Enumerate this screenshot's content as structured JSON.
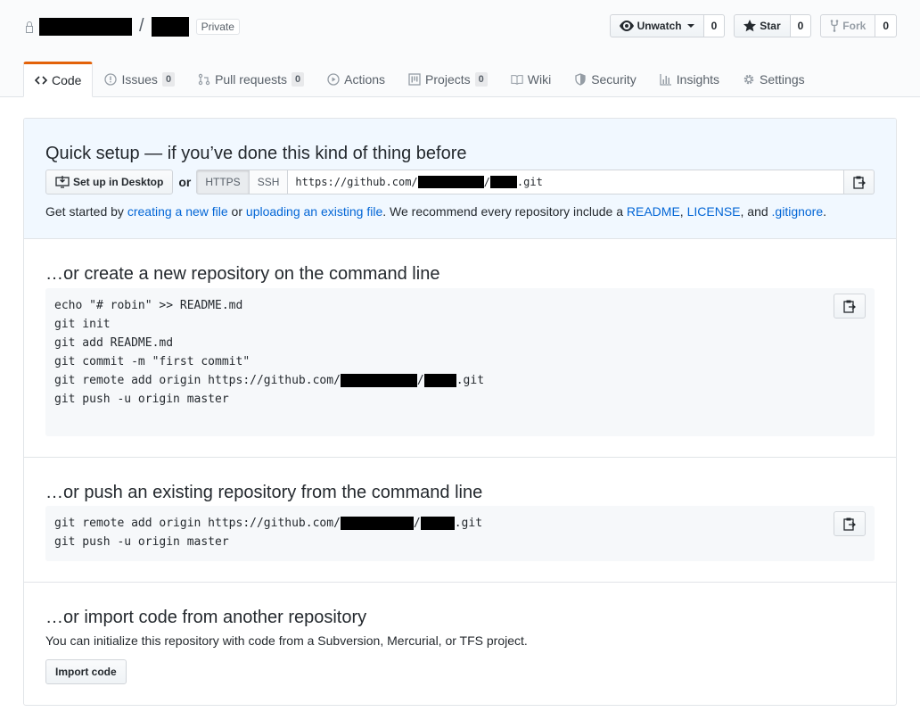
{
  "repo": {
    "separator": "/",
    "visibility": "Private"
  },
  "actions": {
    "watch": {
      "label": "Unwatch",
      "count": "0"
    },
    "star": {
      "label": "Star",
      "count": "0"
    },
    "fork": {
      "label": "Fork",
      "count": "0"
    }
  },
  "nav": {
    "code": "Code",
    "issues": {
      "label": "Issues",
      "count": "0"
    },
    "pulls": {
      "label": "Pull requests",
      "count": "0"
    },
    "actions": "Actions",
    "projects": {
      "label": "Projects",
      "count": "0"
    },
    "wiki": "Wiki",
    "security": "Security",
    "insights": "Insights",
    "settings": "Settings"
  },
  "quick_setup": {
    "title": "Quick setup — if you’ve done this kind of thing before",
    "desktop_button": "Set up in Desktop",
    "or": "or",
    "https": "HTTPS",
    "ssh": "SSH",
    "url_prefix": "https://github.com/",
    "url_slash": "/",
    "url_suffix": ".git",
    "help": {
      "t1": "Get started by ",
      "l1": "creating a new file",
      "t2": " or ",
      "l2": "uploading an existing file",
      "t3": ". We recommend every repository include a ",
      "l3": "README",
      "t4": ", ",
      "l4": "LICENSE",
      "t5": ", and ",
      "l5": ".gitignore",
      "t6": "."
    }
  },
  "create_section": {
    "title": "…or create a new repository on the command line",
    "line1": "echo \"# robin\" >> README.md",
    "line2": "git init",
    "line3": "git add README.md",
    "line4": "git commit -m \"first commit\"",
    "line5_prefix": "git remote add origin https://github.com/",
    "line5_slash": "/",
    "line5_suffix": ".git",
    "line6": "git push -u origin master"
  },
  "push_section": {
    "title": "…or push an existing repository from the command line",
    "line1_prefix": "git remote add origin https://github.com/",
    "line1_slash": "/",
    "line1_suffix": ".git",
    "line2": "git push -u origin master"
  },
  "import_section": {
    "title": "…or import code from another repository",
    "description": "You can initialize this repository with code from a Subversion, Mercurial, or TFS project.",
    "button": "Import code"
  }
}
